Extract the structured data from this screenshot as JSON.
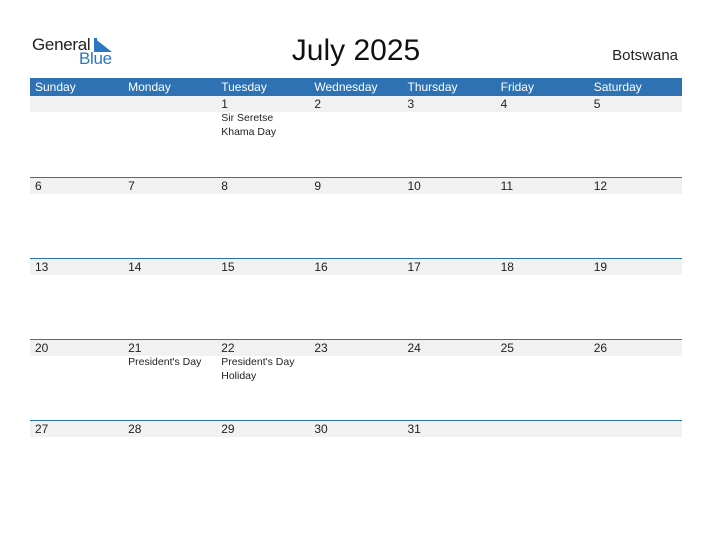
{
  "logo": {
    "line1": "General",
    "line2": "Blue"
  },
  "title": "July 2025",
  "country": "Botswana",
  "colors": {
    "header_bg": "#2e72b3",
    "date_strip": "#f1f1f1",
    "brand_blue": "#2a78c4"
  },
  "weekdays": [
    "Sunday",
    "Monday",
    "Tuesday",
    "Wednesday",
    "Thursday",
    "Friday",
    "Saturday"
  ],
  "weeks": [
    {
      "dates": [
        "",
        "",
        "1",
        "2",
        "3",
        "4",
        "5"
      ],
      "events": [
        "",
        "",
        "Sir Seretse Khama Day",
        "",
        "",
        "",
        ""
      ]
    },
    {
      "dates": [
        "6",
        "7",
        "8",
        "9",
        "10",
        "11",
        "12"
      ],
      "events": [
        "",
        "",
        "",
        "",
        "",
        "",
        ""
      ]
    },
    {
      "dates": [
        "13",
        "14",
        "15",
        "16",
        "17",
        "18",
        "19"
      ],
      "events": [
        "",
        "",
        "",
        "",
        "",
        "",
        ""
      ]
    },
    {
      "dates": [
        "20",
        "21",
        "22",
        "23",
        "24",
        "25",
        "26"
      ],
      "events": [
        "",
        "President's Day",
        "President's Day Holiday",
        "",
        "",
        "",
        ""
      ]
    },
    {
      "dates": [
        "27",
        "28",
        "29",
        "30",
        "31",
        "",
        ""
      ],
      "events": [
        "",
        "",
        "",
        "",
        "",
        "",
        ""
      ]
    }
  ]
}
